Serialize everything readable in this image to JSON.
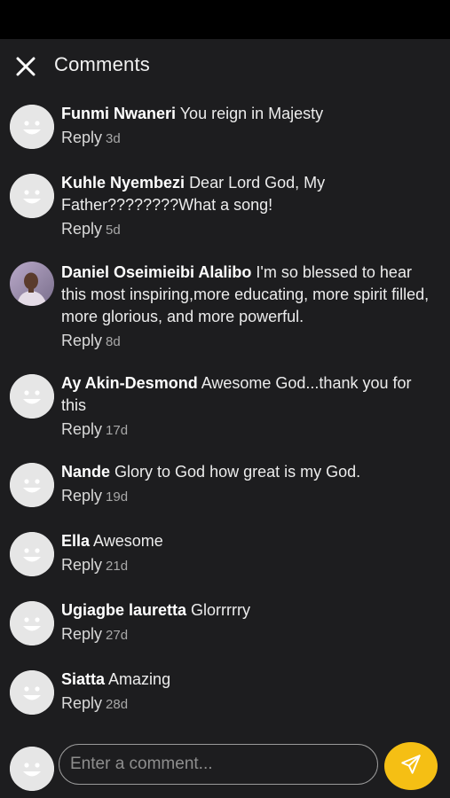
{
  "header": {
    "title": "Comments",
    "close_icon": "close-icon"
  },
  "comments": [
    {
      "author": "Funmi Nwaneri",
      "text": "You reign in Majesty",
      "reply": "Reply",
      "age": "3d",
      "avatar": "default"
    },
    {
      "author": "Kuhle Nyembezi",
      "text": "Dear Lord God, My Father????????What a song!",
      "reply": "Reply",
      "age": "5d",
      "avatar": "default"
    },
    {
      "author": "Daniel Oseimieibi Alalibo",
      "text": "I'm so blessed to hear this most inspiring,more educating, more spirit filled, more  glorious, and more powerful.",
      "reply": "Reply",
      "age": "8d",
      "avatar": "photo"
    },
    {
      "author": "Ay Akin-Desmond",
      "text": "Awesome God...thank you for this",
      "reply": "Reply",
      "age": "17d",
      "avatar": "default"
    },
    {
      "author": "Nande",
      "text": "Glory to God how great is my God.",
      "reply": "Reply",
      "age": "19d",
      "avatar": "default"
    },
    {
      "author": "Ella",
      "text": "Awesome",
      "reply": "Reply",
      "age": "21d",
      "avatar": "default"
    },
    {
      "author": "Ugiagbe lauretta",
      "text": "Glorrrrry",
      "reply": "Reply",
      "age": "27d",
      "avatar": "default"
    },
    {
      "author": "Siatta",
      "text": "Amazing",
      "reply": "Reply",
      "age": "28d",
      "avatar": "default"
    }
  ],
  "composer": {
    "placeholder": "Enter a comment...",
    "value": "",
    "send_icon": "send-icon"
  },
  "colors": {
    "background": "#1d1d1f",
    "status_bar": "#000000",
    "accent": "#f5bf14",
    "avatar_default": "#e6e6e6"
  }
}
